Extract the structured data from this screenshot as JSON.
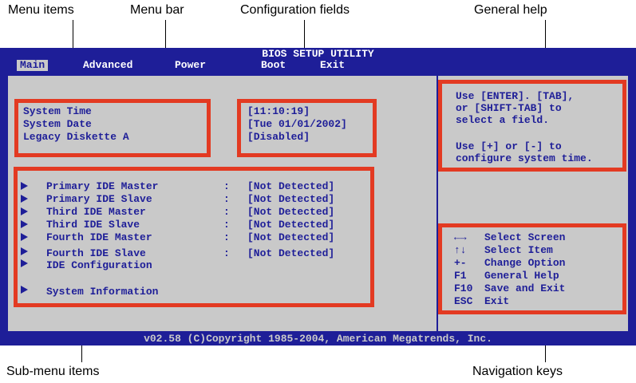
{
  "callouts": {
    "menu_items": "Menu items",
    "menu_bar": "Menu bar",
    "config_fields": "Configuration fields",
    "general_help": "General help",
    "submenu_items": "Sub-menu items",
    "navigation_keys": "Navigation keys"
  },
  "bios": {
    "title": "BIOS SETUP UTILITY",
    "menus": [
      "Main",
      "Advanced",
      "Power",
      "Boot",
      "Exit"
    ],
    "active_menu": "Main",
    "settings": [
      {
        "label": "System Time",
        "value": "[11:10:19]"
      },
      {
        "label": "System Date",
        "value": "[Tue 01/01/2002]"
      },
      {
        "label": "Legacy Diskette A",
        "value": "[Disabled]"
      }
    ],
    "submenus": [
      {
        "label": "Primary IDE Master",
        "sep": ":",
        "value": "[Not Detected]"
      },
      {
        "label": "Primary IDE Slave",
        "sep": ":",
        "value": "[Not Detected]"
      },
      {
        "label": "Third IDE Master",
        "sep": ":",
        "value": "[Not Detected]"
      },
      {
        "label": "Third IDE Slave",
        "sep": ":",
        "value": "[Not Detected]"
      },
      {
        "label": "Fourth IDE Master",
        "sep": ":",
        "value": "[Not Detected]"
      },
      {
        "label": "Fourth IDE Slave",
        "sep": ":",
        "value": "[Not Detected]"
      },
      {
        "label": "IDE Configuration"
      },
      {
        "label": "System Information"
      }
    ],
    "help_lines": [
      "Use [ENTER]. [TAB],",
      "or [SHIFT-TAB] to",
      "select a field.",
      "",
      "Use [+] or [-] to",
      "configure system time."
    ],
    "nav_keys": [
      {
        "key": "←→",
        "action": "Select Screen"
      },
      {
        "key": "↑↓",
        "action": "Select Item"
      },
      {
        "key": "+-",
        "action": "Change Option"
      },
      {
        "key": "F1",
        "action": "General Help"
      },
      {
        "key": "F10",
        "action": "Save and Exit"
      },
      {
        "key": "ESC",
        "action": "Exit"
      }
    ],
    "footer": "v02.58 (C)Copyright 1985-2004, American Megatrends, Inc."
  },
  "colors": {
    "bios_blue": "#1e1e98",
    "panel_gray": "#c9c9c9",
    "highlight_red": "#e33a22"
  }
}
